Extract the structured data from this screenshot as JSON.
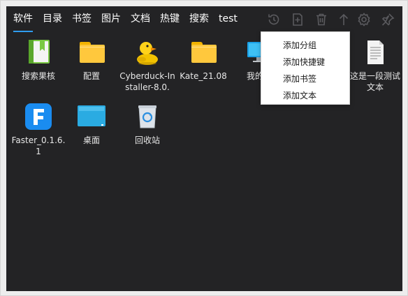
{
  "tabs": [
    {
      "label": "软件",
      "active": true
    },
    {
      "label": "目录"
    },
    {
      "label": "书签"
    },
    {
      "label": "图片"
    },
    {
      "label": "文档"
    },
    {
      "label": "热键"
    },
    {
      "label": "搜索"
    },
    {
      "label": "test"
    }
  ],
  "toolbar": {
    "icons": [
      "history-icon",
      "add-icon",
      "trash-icon",
      "upload-icon",
      "gear-icon",
      "pin-icon"
    ]
  },
  "items": [
    {
      "label": "搜索果核",
      "icon": "bookmark-app-icon"
    },
    {
      "label": "配置",
      "icon": "folder-icon"
    },
    {
      "label": "Cyberduck-Installer-8.0.",
      "icon": "duck-icon"
    },
    {
      "label": "Kate_21.08",
      "icon": "folder-icon"
    },
    {
      "label": "我的电",
      "icon": "monitor-icon"
    },
    {
      "label": "这是一段测试文本",
      "icon": "text-file-icon"
    },
    {
      "label": "Faster_0.1.6.1",
      "icon": "faster-app-icon"
    },
    {
      "label": "桌面",
      "icon": "desktop-icon"
    },
    {
      "label": "回收站",
      "icon": "recycle-bin-icon"
    }
  ],
  "context_menu": {
    "items": [
      "添加分组",
      "添加快捷键",
      "添加书签",
      "添加文本"
    ]
  },
  "colors": {
    "background": "#232325",
    "accent": "#2f9cf0",
    "folder": "#ffc83d"
  }
}
